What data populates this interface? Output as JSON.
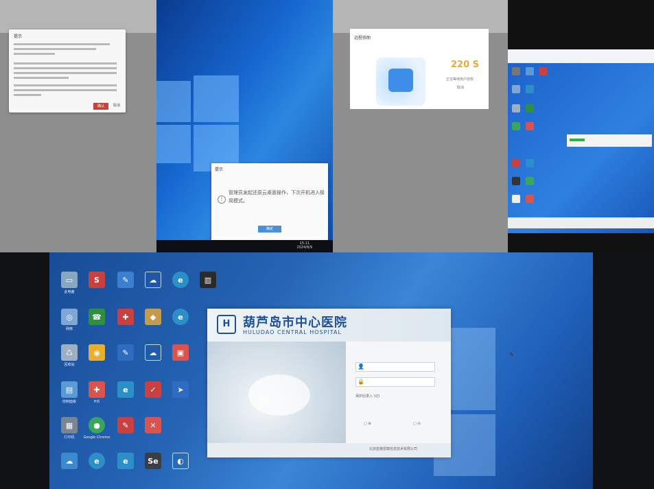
{
  "panel1": {
    "nav_items": [
      "",
      "",
      "",
      ""
    ],
    "dialog": {
      "title": "提示",
      "confirm": "确认",
      "cancel": "取消"
    }
  },
  "panel2": {
    "dialog": {
      "title": "提示",
      "message": "管理员发起还原云桌面操作，下次开机进入极简模式。",
      "ok": "确定"
    },
    "clock_time": "15:11",
    "clock_date": "2024/8/9"
  },
  "panel3": {
    "dialog": {
      "title": "远程协助",
      "countdown": "220 S",
      "subtitle": "正在等待用户授权",
      "cancel": "取消"
    }
  },
  "login_app": {
    "logo_text": "H",
    "title_cn": "葫芦岛市中心医院",
    "title_en": "HULUDAO CENTRAL HOSPITAL",
    "username_icon": "user-icon",
    "password_icon": "lock-icon",
    "remember_label": "保护后录入 (记)",
    "footer": "北京蓝格思康信息技术有限公司"
  },
  "desktop_icons": [
    {
      "label": "此电脑",
      "icon": "computer-icon",
      "color": "#8aa7c2"
    },
    {
      "label": "网络",
      "icon": "network-icon",
      "color": "#7fa7d6"
    },
    {
      "label": "回收站",
      "icon": "recycle-icon",
      "color": "#9db0c3"
    },
    {
      "label": "控制面板",
      "icon": "control-panel-icon",
      "color": "#5b9bd5"
    },
    {
      "label": "打印机",
      "icon": "printer-icon",
      "color": "#7a8591"
    },
    {
      "label": "",
      "icon": "cloud-icon",
      "color": "#3c89d0"
    },
    {
      "label": "",
      "icon": "app-red-icon",
      "color": "#c84040"
    },
    {
      "label": "",
      "icon": "phone-icon",
      "color": "#2f8f3f"
    },
    {
      "label": "",
      "icon": "chrome-icon",
      "color": "#e6b02e"
    },
    {
      "label": "HIS",
      "icon": "doctor-icon",
      "color": "#d9534f"
    },
    {
      "label": "Google Chrome",
      "icon": "chrome-icon",
      "color": "#3aa55d"
    },
    {
      "label": "",
      "icon": "edge-icon",
      "color": "#2d8fc8"
    }
  ]
}
